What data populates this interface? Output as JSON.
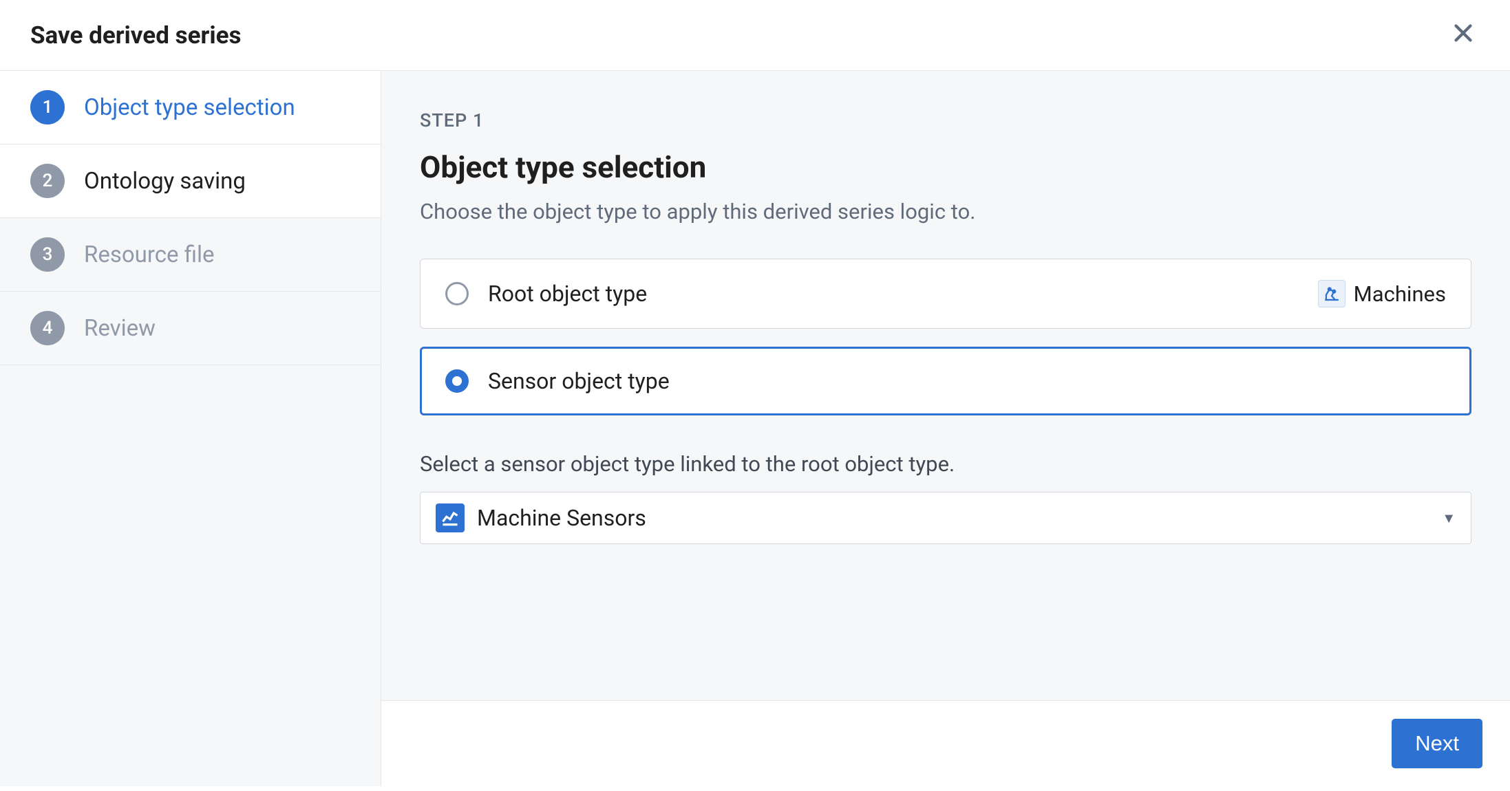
{
  "dialog": {
    "title": "Save derived series"
  },
  "steps": [
    {
      "num": "1",
      "label": "Object type selection"
    },
    {
      "num": "2",
      "label": "Ontology saving"
    },
    {
      "num": "3",
      "label": "Resource file"
    },
    {
      "num": "4",
      "label": "Review"
    }
  ],
  "main": {
    "step_label": "STEP 1",
    "heading": "Object type selection",
    "description": "Choose the object type to apply this derived series logic to.",
    "options": {
      "root": {
        "label": "Root object type",
        "tag": "Machines"
      },
      "sensor": {
        "label": "Sensor object type"
      }
    },
    "helper": "Select a sensor object type linked to the root object type.",
    "select_value": "Machine Sensors"
  },
  "footer": {
    "next": "Next"
  }
}
